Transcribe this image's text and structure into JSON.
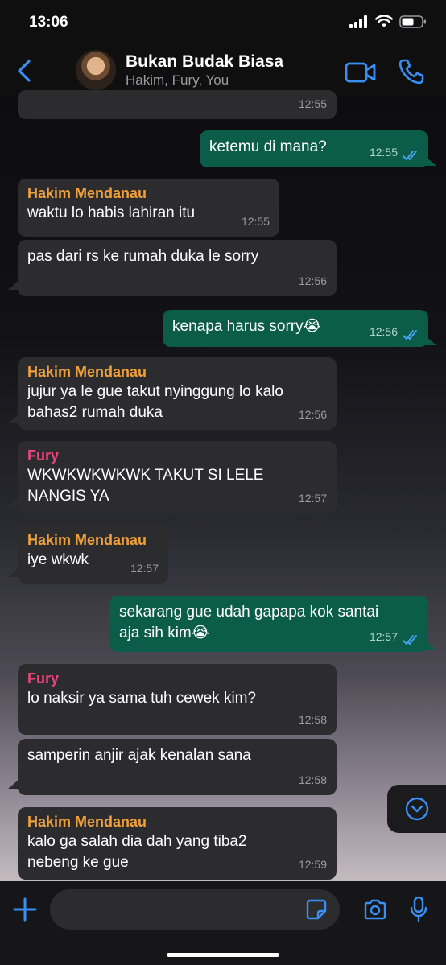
{
  "status": {
    "time": "13:06"
  },
  "header": {
    "title": "Bukan Budak Biasa",
    "subtitle": "Hakim, Fury, You"
  },
  "messages": [
    {
      "dir": "in",
      "sender": "",
      "text": "",
      "time": "12:55"
    },
    {
      "dir": "out",
      "text": "ketemu di mana?",
      "time": "12:55"
    },
    {
      "dir": "in",
      "sender": "Hakim Mendanau",
      "text": "waktu lo habis lahiran itu",
      "time": "12:55"
    },
    {
      "dir": "in",
      "sender": "",
      "text": "pas dari rs ke rumah duka le sorry",
      "time": "12:56"
    },
    {
      "dir": "out",
      "text": "kenapa harus sorry😭",
      "time": "12:56"
    },
    {
      "dir": "in",
      "sender": "Hakim Mendanau",
      "text": "jujur ya le gue takut nyinggung lo kalo\nbahas2 rumah duka",
      "time": "12:56"
    },
    {
      "dir": "in",
      "sender": "Fury",
      "text": "WKWKWKWKWK TAKUT SI LELE\nNANGIS YA",
      "time": "12:57"
    },
    {
      "dir": "in",
      "sender": "Hakim Mendanau",
      "text": "iye wkwk",
      "time": "12:57"
    },
    {
      "dir": "out",
      "text": "sekarang gue udah gapapa kok santai\naja sih kim😭",
      "time": "12:57"
    },
    {
      "dir": "in",
      "sender": "Fury",
      "text": "lo naksir ya sama tuh cewek kim?",
      "time": "12:58"
    },
    {
      "dir": "in",
      "sender": "",
      "text": "samperin anjir ajak kenalan sana",
      "time": "12:58"
    },
    {
      "dir": "in",
      "sender": "Hakim Mendanau",
      "text": "kalo ga salah dia dah yang tiba2\nnebeng ke gue",
      "time": "12:59"
    }
  ],
  "input": {
    "placeholder": ""
  },
  "colors": {
    "incoming_bubble": "#2c2c2e",
    "outgoing_bubble": "#0b5c48",
    "accent_blue": "#3a8ff5",
    "hakim_name": "#f0a03a",
    "fury_name": "#e8447a"
  },
  "icons": [
    "back-chevron-icon",
    "video-call-icon",
    "voice-call-icon",
    "read-ticks-icon",
    "scroll-down-icon",
    "plus-icon",
    "sticker-icon",
    "camera-icon",
    "mic-icon"
  ]
}
